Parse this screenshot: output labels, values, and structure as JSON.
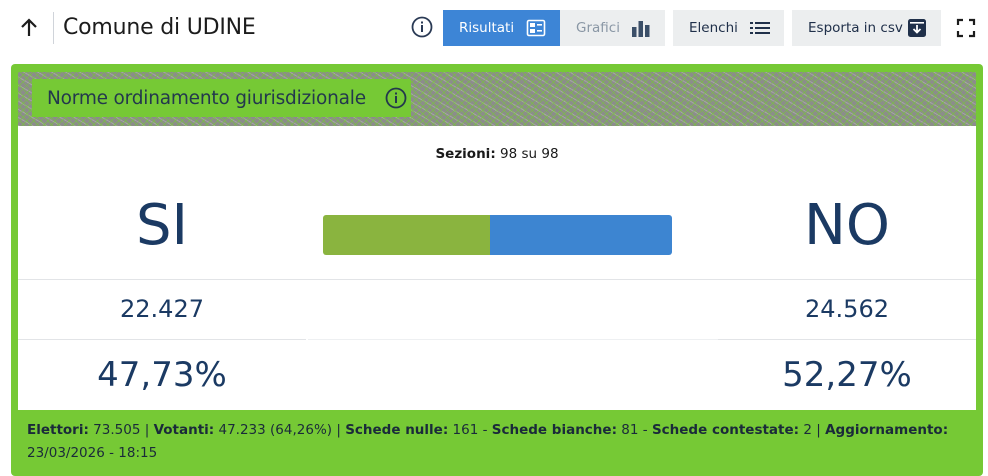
{
  "header": {
    "title": "Comune di UDINE",
    "back_icon": "arrow-up-icon",
    "info_icon": "info-icon",
    "buttons": {
      "risultati": "Risultati",
      "grafici": "Grafici",
      "elenchi": "Elenchi",
      "esporta": "Esporta in csv"
    },
    "fullscreen_icon": "fullscreen-icon"
  },
  "card": {
    "question_label": "Norme ordinamento giurisdizionale",
    "sezioni_label": "Sezioni:",
    "sezioni_value": "98 su 98",
    "yes": {
      "label": "SI",
      "votes": "22.427",
      "percent": "47,73%",
      "percent_value": 47.73,
      "color": "#8ab43f"
    },
    "no": {
      "label": "NO",
      "votes": "24.562",
      "percent": "52,27%",
      "percent_value": 52.27,
      "color": "#3d85d1"
    }
  },
  "footer": {
    "elettori_label": "Elettori:",
    "elettori_value": "73.505",
    "votanti_label": "Votanti:",
    "votanti_value": "47.233 (64,26%)",
    "nulle_label": "Schede nulle:",
    "nulle_value": "161",
    "bianche_label": "Schede bianche:",
    "bianche_value": "81",
    "contestate_label": "Schede contestate:",
    "contestate_value": "2",
    "aggiornamento_label": "Aggiornamento:",
    "aggiornamento_value": "23/03/2026 - 18:15"
  },
  "colors": {
    "accent_blue": "#3d85d6",
    "card_green": "#76c935",
    "text_dark_blue": "#1b3a63"
  }
}
